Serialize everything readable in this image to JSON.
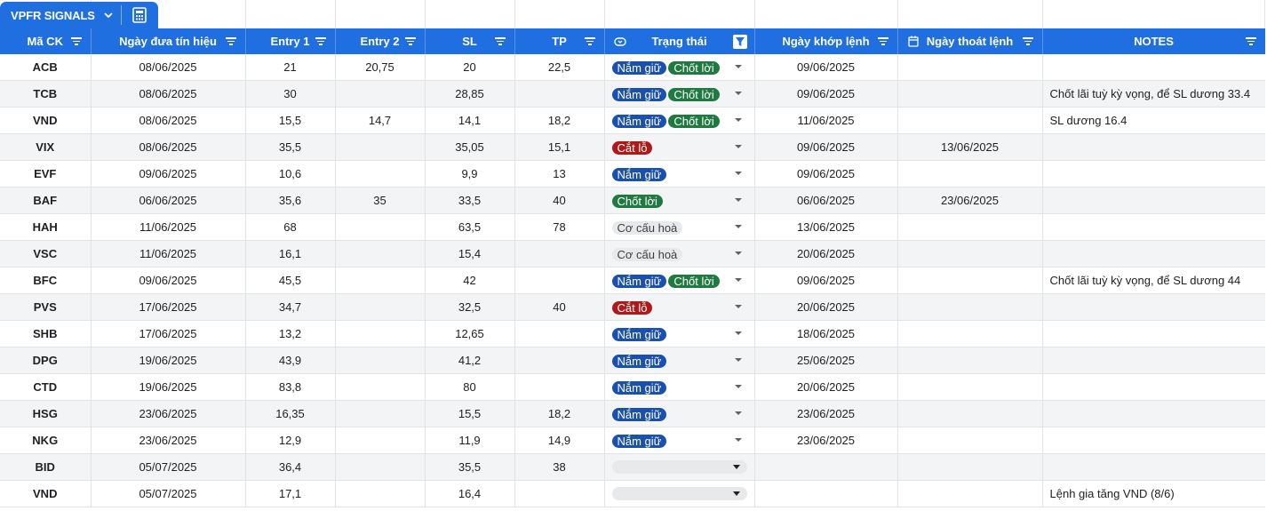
{
  "tab": {
    "name": "VPFR SIGNALS"
  },
  "columns": [
    {
      "label": "Mã CK"
    },
    {
      "label": "Ngày đưa tín hiệu"
    },
    {
      "label": "Entry 1"
    },
    {
      "label": "Entry 2"
    },
    {
      "label": "SL"
    },
    {
      "label": "TP"
    },
    {
      "label": "Trạng thái"
    },
    {
      "label": "Ngày khớp lệnh"
    },
    {
      "label": "Ngày thoát lệnh"
    },
    {
      "label": "NOTES"
    }
  ],
  "rows": [
    {
      "code": "ACB",
      "signal_date": "08/06/2025",
      "entry1": "21",
      "entry2": "20,75",
      "sl": "20",
      "tp": "22,5",
      "status": [
        "Nắm giữ",
        "Chốt lời"
      ],
      "match_date": "09/06/2025",
      "exit_date": "",
      "notes": ""
    },
    {
      "code": "TCB",
      "signal_date": "08/06/2025",
      "entry1": "30",
      "entry2": "",
      "sl": "28,85",
      "tp": "",
      "status": [
        "Nắm giữ",
        "Chốt lời"
      ],
      "match_date": "09/06/2025",
      "exit_date": "",
      "notes": "Chốt lãi tuỳ kỳ vọng, để SL dương 33.4"
    },
    {
      "code": "VND",
      "signal_date": "08/06/2025",
      "entry1": "15,5",
      "entry2": "14,7",
      "sl": "14,1",
      "tp": "18,2",
      "status": [
        "Nắm giữ",
        "Chốt lời"
      ],
      "match_date": "11/06/2025",
      "exit_date": "",
      "notes": "SL dương 16.4"
    },
    {
      "code": "VIX",
      "signal_date": "08/06/2025",
      "entry1": "35,5",
      "entry2": "",
      "sl": "35,05",
      "tp": "15,1",
      "status": [
        "Cắt lỗ"
      ],
      "match_date": "09/06/2025",
      "exit_date": "13/06/2025",
      "notes": ""
    },
    {
      "code": "EVF",
      "signal_date": "09/06/2025",
      "entry1": "10,6",
      "entry2": "",
      "sl": "9,9",
      "tp": "13",
      "status": [
        "Nắm giữ"
      ],
      "match_date": "09/06/2025",
      "exit_date": "",
      "notes": ""
    },
    {
      "code": "BAF",
      "signal_date": "06/06/2025",
      "entry1": "35,6",
      "entry2": "35",
      "sl": "33,5",
      "tp": "40",
      "status": [
        "Chốt lời"
      ],
      "match_date": "06/06/2025",
      "exit_date": "23/06/2025",
      "notes": ""
    },
    {
      "code": "HAH",
      "signal_date": "11/06/2025",
      "entry1": "68",
      "entry2": "",
      "sl": "63,5",
      "tp": "78",
      "status": [
        "Cơ cấu hoà"
      ],
      "match_date": "13/06/2025",
      "exit_date": "",
      "notes": ""
    },
    {
      "code": "VSC",
      "signal_date": "11/06/2025",
      "entry1": "16,1",
      "entry2": "",
      "sl": "15,4",
      "tp": "",
      "status": [
        "Cơ cấu hoà"
      ],
      "match_date": "20/06/2025",
      "exit_date": "",
      "notes": ""
    },
    {
      "code": "BFC",
      "signal_date": "09/06/2025",
      "entry1": "45,5",
      "entry2": "",
      "sl": "42",
      "tp": "",
      "status": [
        "Nắm giữ",
        "Chốt lời"
      ],
      "match_date": "09/06/2025",
      "exit_date": "",
      "notes": "Chốt lãi tuỳ kỳ vọng, để SL dương 44"
    },
    {
      "code": "PVS",
      "signal_date": "17/06/2025",
      "entry1": "34,7",
      "entry2": "",
      "sl": "32,5",
      "tp": "40",
      "status": [
        "Cắt lỗ"
      ],
      "match_date": "20/06/2025",
      "exit_date": "",
      "notes": ""
    },
    {
      "code": "SHB",
      "signal_date": "17/06/2025",
      "entry1": "13,2",
      "entry2": "",
      "sl": "12,65",
      "tp": "",
      "status": [
        "Nắm giữ"
      ],
      "match_date": "18/06/2025",
      "exit_date": "",
      "notes": ""
    },
    {
      "code": "DPG",
      "signal_date": "19/06/2025",
      "entry1": "43,9",
      "entry2": "",
      "sl": "41,2",
      "tp": "",
      "status": [
        "Nắm giữ"
      ],
      "match_date": "25/06/2025",
      "exit_date": "",
      "notes": ""
    },
    {
      "code": "CTD",
      "signal_date": "19/06/2025",
      "entry1": "83,8",
      "entry2": "",
      "sl": "80",
      "tp": "",
      "status": [
        "Nắm giữ"
      ],
      "match_date": "20/06/2025",
      "exit_date": "",
      "notes": ""
    },
    {
      "code": "HSG",
      "signal_date": "23/06/2025",
      "entry1": "16,35",
      "entry2": "",
      "sl": "15,5",
      "tp": "18,2",
      "status": [
        "Nắm giữ"
      ],
      "match_date": "23/06/2025",
      "exit_date": "",
      "notes": ""
    },
    {
      "code": "NKG",
      "signal_date": "23/06/2025",
      "entry1": "12,9",
      "entry2": "",
      "sl": "11,9",
      "tp": "14,9",
      "status": [
        "Nắm giữ"
      ],
      "match_date": "23/06/2025",
      "exit_date": "",
      "notes": ""
    },
    {
      "code": "BID",
      "signal_date": "05/07/2025",
      "entry1": "36,4",
      "entry2": "",
      "sl": "35,5",
      "tp": "38",
      "status": [],
      "match_date": "",
      "exit_date": "",
      "notes": ""
    },
    {
      "code": "VND",
      "signal_date": "05/07/2025",
      "entry1": "17,1",
      "entry2": "",
      "sl": "16,4",
      "tp": "",
      "status": [],
      "match_date": "",
      "exit_date": "",
      "notes": "Lệnh gia tăng VND (8/6)"
    }
  ],
  "colors": {
    "header": "#1f6fe0",
    "hold": "#1a50b0",
    "profit": "#1f7a3f",
    "loss": "#b0191a",
    "restructure": "#e8e9eb"
  }
}
